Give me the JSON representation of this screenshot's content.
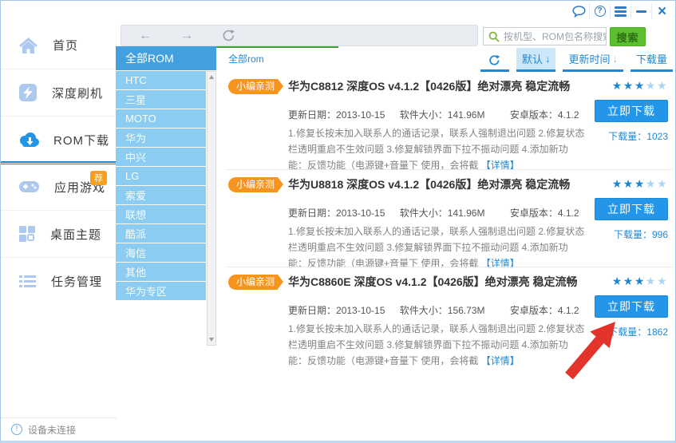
{
  "icons": {
    "back": "←",
    "forward": "→",
    "down_arrow": "↓",
    "close": "×",
    "help": "?",
    "star": "★",
    "info": "!"
  },
  "sidebar": {
    "items": [
      {
        "label": "首页"
      },
      {
        "label": "深度刷机"
      },
      {
        "label": "ROM下载"
      },
      {
        "label": "应用游戏",
        "badge": "荐"
      },
      {
        "label": "桌面主题"
      },
      {
        "label": "任务管理"
      }
    ],
    "status": "设备未连接"
  },
  "toolbar": {
    "search_placeholder": "按机型、ROM包名称搜索",
    "search_button": "搜索"
  },
  "categories": {
    "selected": "全部ROM",
    "items": [
      "HTC",
      "三星",
      "MOTO",
      "华为",
      "中兴",
      "LG",
      "索爱",
      "联想",
      "酷派",
      "海信",
      "其他",
      "华为专区"
    ]
  },
  "content": {
    "breadcrumb": "全部rom",
    "sort": {
      "default": "默认",
      "by_time": "更新时间",
      "by_downloads": "下载量"
    },
    "roms": [
      {
        "badge": "小编亲测",
        "title": "华为C8812 深度OS v4.1.2【0426版】绝对漂亮 稳定流畅",
        "meta": {
          "update_label": "更新日期：",
          "update": "2013-10-15",
          "size_label": "软件大小：",
          "size": "141.96M",
          "android_label": "安卓版本：",
          "android": "4.1.2"
        },
        "desc": "1.修复长按未加入联系人的通话记录，联系人强制退出问题 2.修复状态栏透明重启不生效问题 3.修复解锁界面下拉不振动问题 4.添加新功能：反馈功能（电源键+音量下 使用，会将截",
        "detail_link": "【详情】",
        "rating": 3,
        "download_button": "立即下载",
        "downloads_label": "下载量：",
        "downloads": "1023"
      },
      {
        "badge": "小编亲测",
        "title": "华为U8818 深度OS v4.1.2【0426版】绝对漂亮 稳定流畅",
        "meta": {
          "update_label": "更新日期：",
          "update": "2013-10-15",
          "size_label": "软件大小：",
          "size": "141.96M",
          "android_label": "安卓版本：",
          "android": "4.1.2"
        },
        "desc": "1.修复长按未加入联系人的通话记录，联系人强制退出问题 2.修复状态栏透明重启不生效问题 3.修复解锁界面下拉不振动问题 4.添加新功能：反馈功能（电源键+音量下 使用，会将截",
        "detail_link": "【详情】",
        "rating": 3,
        "download_button": "立即下载",
        "downloads_label": "下载量：",
        "downloads": "996"
      },
      {
        "badge": "小编亲测",
        "title": "华为C8860E 深度OS v4.1.2【0426版】绝对漂亮 稳定流畅",
        "meta": {
          "update_label": "更新日期：",
          "update": "2013-10-15",
          "size_label": "软件大小：",
          "size": "156.73M",
          "android_label": "安卓版本：",
          "android": "4.1.2"
        },
        "desc": "1.修复长按未加入联系人的通话记录，联系人强制退出问题 2.修复状态栏透明重启不生效问题 3.修复解锁界面下拉不振动问题 4.添加新功能：反馈功能（电源键+音量下 使用，会将截",
        "detail_link": "【详情】",
        "rating": 3,
        "download_button": "立即下载",
        "downloads_label": "下载量：",
        "downloads": "1862"
      }
    ]
  }
}
